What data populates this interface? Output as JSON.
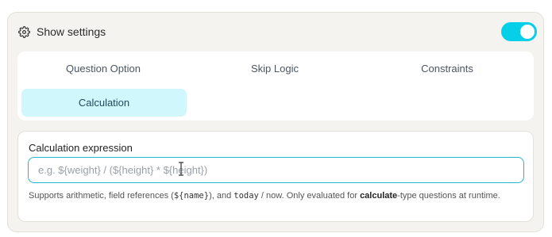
{
  "settings": {
    "header_label": "Show settings",
    "toggle_on": true
  },
  "tabs": [
    {
      "label": "Question Option",
      "active": false
    },
    {
      "label": "Skip Logic",
      "active": false
    },
    {
      "label": "Constraints",
      "active": false
    },
    {
      "label": "Calculation",
      "active": true
    }
  ],
  "calculation": {
    "label": "Calculation expression",
    "value": "",
    "placeholder": "e.g. ${weight} / (${height} * ${height})",
    "help": {
      "t1": "Supports arithmetic, field references (",
      "code1": "${name}",
      "t2": "), and ",
      "code2": "today",
      "t3": " / now. Only evaluated for ",
      "bold1": "calculate",
      "t4": "-type questions at runtime."
    }
  },
  "colors": {
    "accent": "#06cfe8",
    "active_tab_bg": "#d0f7fb",
    "input_border": "#23b7cf",
    "panel_bg": "#f4f3ef"
  }
}
